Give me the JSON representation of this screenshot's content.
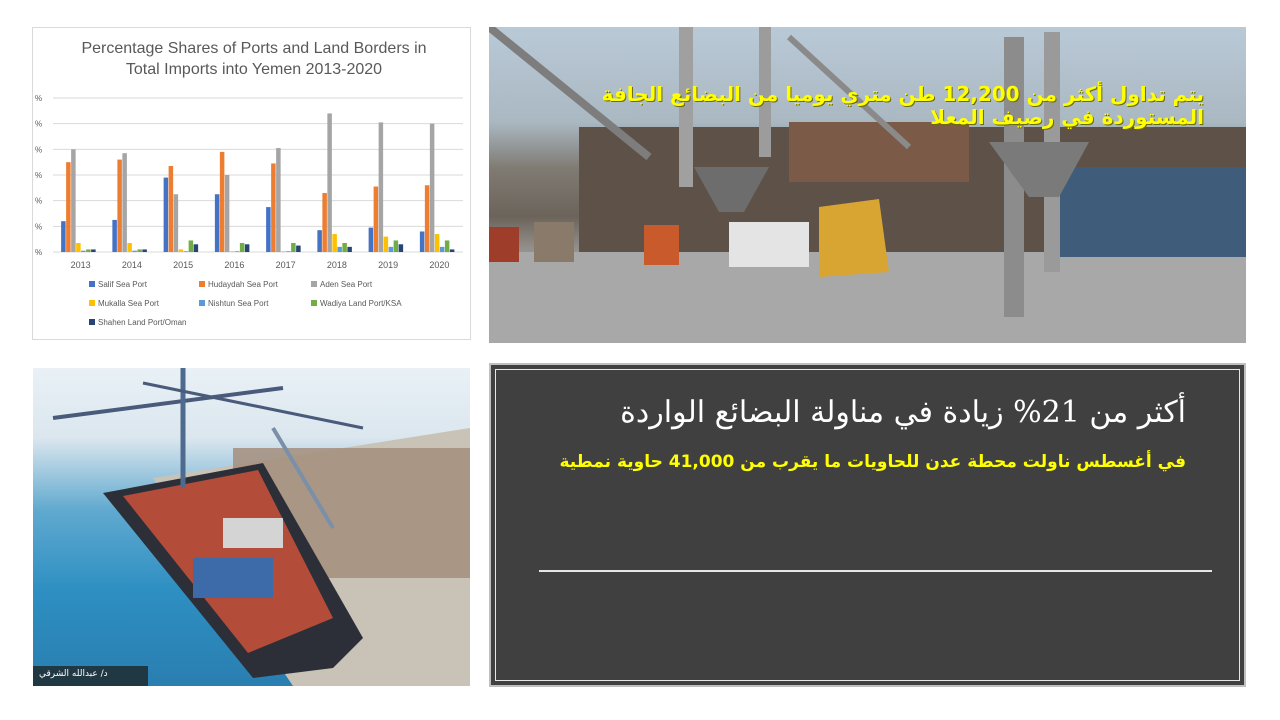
{
  "chart_data": {
    "type": "bar",
    "title": "Percentage Shares of Ports and Land Borders in Total Imports into Yemen 2013-2020",
    "title_lines": [
      "Percentage Shares of Ports and Land Borders in",
      "Total Imports into Yemen 2013-2020"
    ],
    "categories": [
      "2013",
      "2014",
      "2015",
      "2016",
      "2017",
      "2018",
      "2019",
      "2020"
    ],
    "y_tick_labels": [
      "%",
      "%",
      "%",
      "%",
      "%",
      "%",
      "%"
    ],
    "ylim": [
      0,
      60
    ],
    "grid": true,
    "legend_position": "bottom",
    "series": [
      {
        "name": "Salif Sea Port",
        "color": "#4472c4",
        "values": [
          12,
          12.5,
          29,
          22.5,
          17.5,
          8.5,
          9.5,
          8
        ]
      },
      {
        "name": "Hudaydah Sea Port",
        "color": "#ed7d31",
        "values": [
          35,
          36,
          33.5,
          39,
          34.5,
          23,
          25.5,
          26
        ]
      },
      {
        "name": "Aden Sea Port",
        "color": "#a5a5a5",
        "values": [
          40,
          38.5,
          22.5,
          30,
          40.5,
          54,
          50.5,
          50
        ]
      },
      {
        "name": "Mukalla Sea Port",
        "color": "#ffc000",
        "values": [
          3.5,
          3.5,
          1,
          0.3,
          0.3,
          7,
          6,
          7
        ]
      },
      {
        "name": "Nishtun Sea Port",
        "color": "#5b9bd5",
        "values": [
          0.5,
          0.5,
          0.3,
          0.3,
          0.3,
          2,
          2,
          2
        ]
      },
      {
        "name": "Wadiya Land Port/KSA",
        "color": "#70ad47",
        "values": [
          1,
          1,
          4.5,
          3.5,
          3.5,
          3.5,
          4.5,
          4.5
        ]
      },
      {
        "name": "Shahen Land Port/Oman",
        "color": "#264478",
        "values": [
          1,
          1,
          3,
          3,
          2.5,
          2,
          3,
          1
        ]
      }
    ]
  },
  "photo1": {
    "caption": "يتم تداول أكثر من 12,200 طن متري يوميا من البضائع الجافة المستوردة في رصيف المعلا",
    "caption_color": "#ffff00"
  },
  "photo2": {
    "watermark": "د/ عبدالله الشرقي"
  },
  "text_panel": {
    "headline": "أكثر من 21% زيادة في مناولة البضائع الواردة",
    "subline": "في أغسطس ناولت محطة عدن للحاويات ما يقرب من 41,000 حاوية نمطية",
    "subline_color": "#ffff00"
  }
}
